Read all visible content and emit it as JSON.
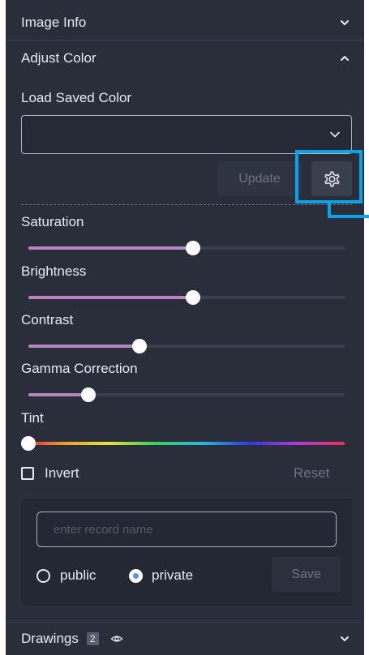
{
  "sections": {
    "image_info": {
      "label": "Image Info",
      "expanded": false
    },
    "adjust_color": {
      "label": "Adjust Color",
      "expanded": true
    },
    "drawings": {
      "label": "Drawings",
      "count": "2",
      "expanded": false
    }
  },
  "adjust": {
    "load_saved_label": "Load Saved Color",
    "select_value": "",
    "update_label": "Update",
    "gear_icon": "gear-icon",
    "sliders": [
      {
        "label": "Saturation",
        "value": 0.52
      },
      {
        "label": "Brightness",
        "value": 0.52
      },
      {
        "label": "Contrast",
        "value": 0.35
      },
      {
        "label": "Gamma Correction",
        "value": 0.19
      }
    ],
    "tint": {
      "label": "Tint",
      "value": 0.0
    },
    "invert_label": "Invert",
    "invert_checked": false,
    "reset_label": "Reset"
  },
  "save_form": {
    "record_name_placeholder": "enter record name",
    "record_name_value": "",
    "visibility_options": [
      "public",
      "private"
    ],
    "selected": "private",
    "save_label": "Save"
  },
  "colors": {
    "panel_bg": "#2a2e3b",
    "slider_fill": "#b786c0",
    "highlight": "#0aa2e8",
    "radio_selected": "#5f8fe8"
  }
}
